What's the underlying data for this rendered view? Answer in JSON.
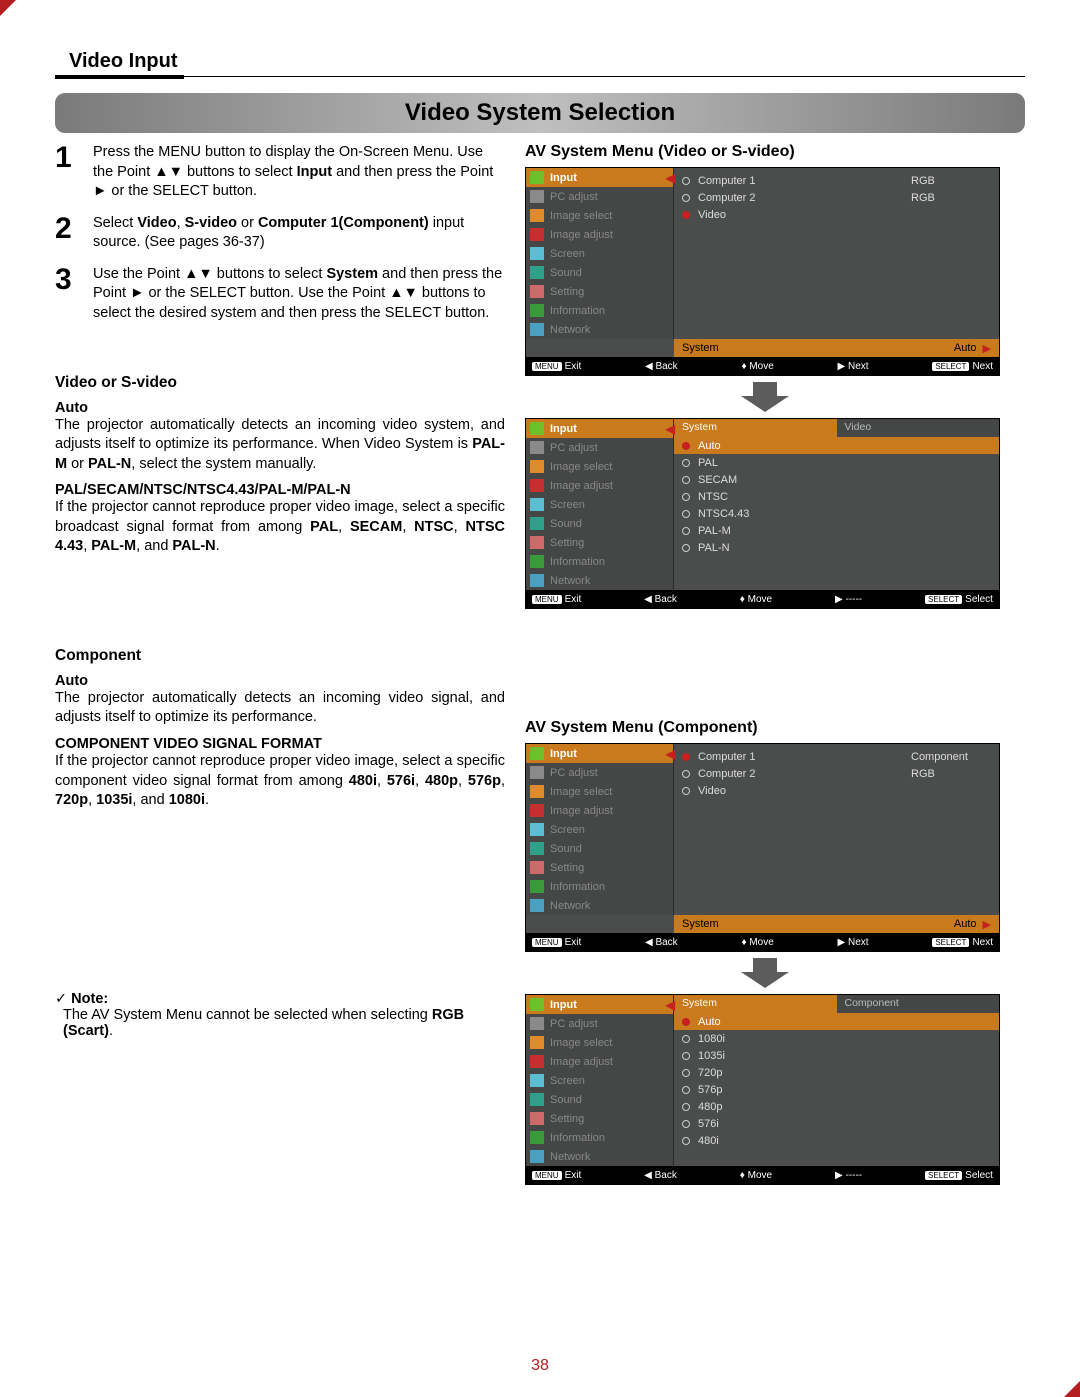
{
  "breadcrumb": "Video Input",
  "title": "Video System Selection",
  "page_number": "38",
  "steps": [
    {
      "num": "1",
      "html": "Press the MENU button to display the On-Screen Menu. Use the Point ▲▼ buttons to select <b>Input</b> and then press the Point ► or the SELECT button."
    },
    {
      "num": "2",
      "html": "Select <b>Video</b>, <b>S-video</b> or <b>Computer 1(Component)</b> input source. (See pages 36-37)"
    },
    {
      "num": "3",
      "html": "Use the Point ▲▼ buttons to select <b>System</b> and then press the Point ► or the SELECT button. Use the Point ▲▼ buttons to select the desired system and then press the SELECT button."
    }
  ],
  "left": {
    "h1": "Video or S-video",
    "auto_label": "Auto",
    "auto_text": "The projector automatically detects an incoming video system, and adjusts itself to optimize its performance. When Video System is <b>PAL-M</b> or <b>PAL-N</b>, select the system manually.",
    "pal_label": "PAL/SECAM/NTSC/NTSC4.43/PAL-M/PAL-N",
    "pal_text": "If the projector cannot reproduce proper video image, select a specific broadcast signal format from among <b>PAL</b>, <b>SECAM</b>, <b>NTSC</b>, <b>NTSC 4.43</b>, <b>PAL-M</b>, and <b>PAL-N</b>.",
    "h2": "Component",
    "auto2_label": "Auto",
    "auto2_text": "The projector automatically detects an incoming video signal, and adjusts itself to optimize its performance.",
    "cvf_label": "COMPONENT VIDEO SIGNAL FORMAT",
    "cvf_text": "If the projector cannot reproduce proper video image, select a specific component video signal format from among <b>480i</b>, <b>576i</b>, <b>480p</b>, <b>576p</b>, <b>720p</b>, <b>1035i</b>, and <b>1080i</b>.",
    "note_label": "Note:",
    "note_text": "The AV System Menu cannot be selected when selecting <b>RGB (Scart)</b>."
  },
  "sidebar_items": [
    {
      "icon": "ic-green",
      "label": "Input"
    },
    {
      "icon": "ic-gray",
      "label": "PC adjust"
    },
    {
      "icon": "ic-orange",
      "label": "Image select"
    },
    {
      "icon": "ic-red",
      "label": "Image adjust"
    },
    {
      "icon": "ic-cyan",
      "label": "Screen"
    },
    {
      "icon": "ic-teal",
      "label": "Sound"
    },
    {
      "icon": "ic-pink",
      "label": "Setting"
    },
    {
      "icon": "ic-greeni",
      "label": "Information"
    },
    {
      "icon": "ic-down",
      "label": "Network"
    }
  ],
  "right": {
    "h1": "AV System Menu (Video or S-video)",
    "h2": "AV System Menu (Component)"
  },
  "osd1": {
    "rows": [
      {
        "sel": false,
        "label": "Computer 1",
        "r": "RGB"
      },
      {
        "sel": false,
        "label": "Computer 2",
        "r": "RGB"
      },
      {
        "sel": true,
        "label": "Video",
        "r": ""
      }
    ],
    "system_label": "System",
    "system_value": "Auto",
    "footer": {
      "exit": "Exit",
      "back": "Back",
      "move": "Move",
      "next": "Next",
      "sel": "Next"
    }
  },
  "osd2": {
    "tabs": [
      "System",
      "Video"
    ],
    "rows": [
      {
        "sel": true,
        "label": "Auto"
      },
      {
        "sel": false,
        "label": "PAL"
      },
      {
        "sel": false,
        "label": "SECAM"
      },
      {
        "sel": false,
        "label": "NTSC"
      },
      {
        "sel": false,
        "label": "NTSC4.43"
      },
      {
        "sel": false,
        "label": "PAL-M"
      },
      {
        "sel": false,
        "label": "PAL-N"
      }
    ],
    "footer": {
      "exit": "Exit",
      "back": "Back",
      "move": "Move",
      "next": "-----",
      "sel": "Select"
    }
  },
  "osd3": {
    "rows": [
      {
        "sel": true,
        "label": "Computer 1",
        "r": "Component"
      },
      {
        "sel": false,
        "label": "Computer 2",
        "r": "RGB"
      },
      {
        "sel": false,
        "label": "Video",
        "r": ""
      }
    ],
    "system_label": "System",
    "system_value": "Auto",
    "footer": {
      "exit": "Exit",
      "back": "Back",
      "move": "Move",
      "next": "Next",
      "sel": "Next"
    }
  },
  "osd4": {
    "tabs": [
      "System",
      "Component"
    ],
    "rows": [
      {
        "sel": true,
        "label": "Auto"
      },
      {
        "sel": false,
        "label": "1080i"
      },
      {
        "sel": false,
        "label": "1035i"
      },
      {
        "sel": false,
        "label": "720p"
      },
      {
        "sel": false,
        "label": "576p"
      },
      {
        "sel": false,
        "label": "480p"
      },
      {
        "sel": false,
        "label": "576i"
      },
      {
        "sel": false,
        "label": "480i"
      }
    ],
    "footer": {
      "exit": "Exit",
      "back": "Back",
      "move": "Move",
      "next": "-----",
      "sel": "Select"
    }
  }
}
